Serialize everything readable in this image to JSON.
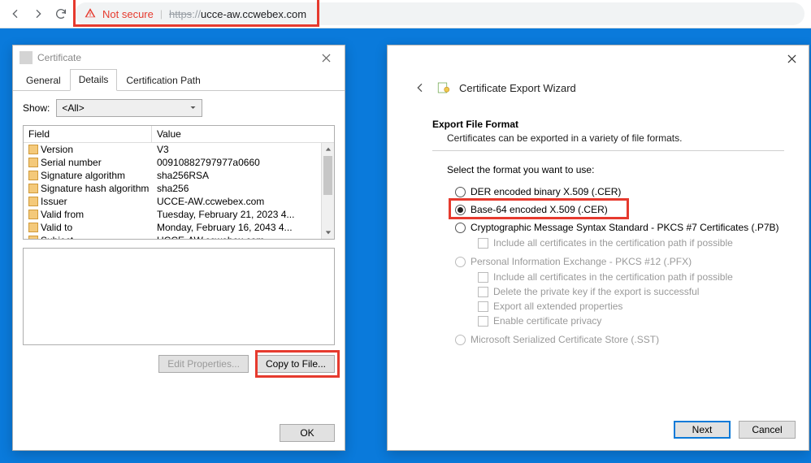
{
  "browser": {
    "not_secure": "Not secure",
    "protocol": "https",
    "slashes": "://",
    "host": "ucce-aw.ccwebex.com"
  },
  "cert_dialog": {
    "title": "Certificate",
    "tabs": {
      "general": "General",
      "details": "Details",
      "path": "Certification Path"
    },
    "show_label": "Show:",
    "show_value": "<All>",
    "headers": {
      "field": "Field",
      "value": "Value"
    },
    "rows": [
      {
        "field": "Version",
        "value": "V3"
      },
      {
        "field": "Serial number",
        "value": "00910882797977a0660"
      },
      {
        "field": "Signature algorithm",
        "value": "sha256RSA"
      },
      {
        "field": "Signature hash algorithm",
        "value": "sha256"
      },
      {
        "field": "Issuer",
        "value": "UCCE-AW.ccwebex.com"
      },
      {
        "field": "Valid from",
        "value": "Tuesday, February 21, 2023 4..."
      },
      {
        "field": "Valid to",
        "value": "Monday, February 16, 2043 4..."
      },
      {
        "field": "Subject",
        "value": "UCCE-AW.ccwebex.com"
      }
    ],
    "buttons": {
      "edit": "Edit Properties...",
      "copy": "Copy to File...",
      "ok": "OK"
    }
  },
  "wizard": {
    "title": "Certificate Export Wizard",
    "section_title": "Export File Format",
    "section_sub": "Certificates can be exported in a variety of file formats.",
    "prompt": "Select the format you want to use:",
    "options": {
      "der": "DER encoded binary X.509 (.CER)",
      "b64": "Base-64 encoded X.509 (.CER)",
      "p7b": "Cryptographic Message Syntax Standard - PKCS #7 Certificates (.P7B)",
      "p7b_sub": "Include all certificates in the certification path if possible",
      "pfx": "Personal Information Exchange - PKCS #12 (.PFX)",
      "pfx_sub1": "Include all certificates in the certification path if possible",
      "pfx_sub2": "Delete the private key if the export is successful",
      "pfx_sub3": "Export all extended properties",
      "pfx_sub4": "Enable certificate privacy",
      "sst": "Microsoft Serialized Certificate Store (.SST)"
    },
    "buttons": {
      "next": "Next",
      "cancel": "Cancel"
    }
  }
}
